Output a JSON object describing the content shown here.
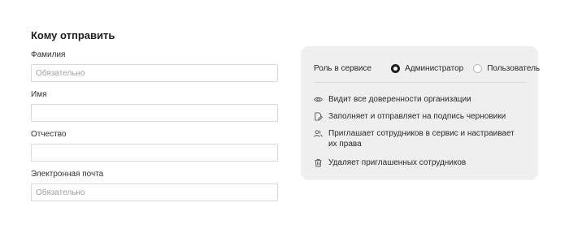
{
  "form": {
    "title": "Кому отправить",
    "fields": [
      {
        "label": "Фамилия",
        "value": "",
        "placeholder": "Обязательно"
      },
      {
        "label": "Имя",
        "value": "",
        "placeholder": ""
      },
      {
        "label": "Отчество",
        "value": "",
        "placeholder": ""
      },
      {
        "label": "Электронная почта",
        "value": "",
        "placeholder": "Обязательно"
      }
    ]
  },
  "role_panel": {
    "label": "Роль в сервисе",
    "options": [
      {
        "label": "Администратор",
        "selected": true
      },
      {
        "label": "Пользователь",
        "selected": false
      }
    ],
    "permissions": [
      {
        "icon": "eye-icon",
        "text": "Видит все доверенности организации"
      },
      {
        "icon": "edit-document-icon",
        "text": "Заполняет и отправляет на подпись черновики"
      },
      {
        "icon": "users-icon",
        "text": "Приглашает сотрудников в сервис и настраивает их права"
      },
      {
        "icon": "trash-icon",
        "text": "Удаляет приглашенных сотрудников"
      }
    ]
  },
  "colors": {
    "panel_bg": "#efefef",
    "radio_checked": "#1f1f1f"
  }
}
